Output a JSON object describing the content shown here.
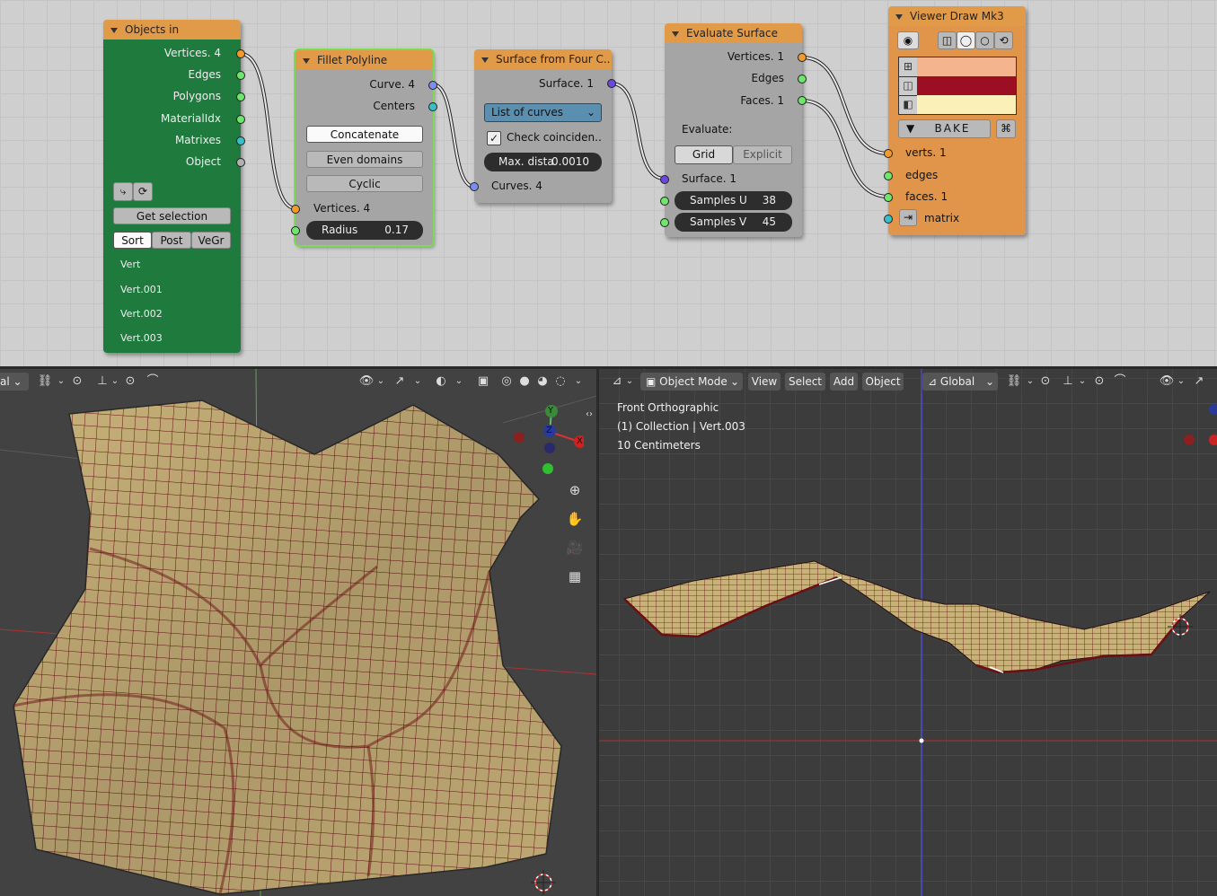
{
  "nodes": {
    "objects_in": {
      "title": "Objects in",
      "outputs": [
        "Vertices. 4",
        "Edges",
        "Polygons",
        "MaterialIdx",
        "Matrixes",
        "Object"
      ],
      "get_selection": "Get selection",
      "sort_tabs": [
        "Sort",
        "Post",
        "VeGr"
      ],
      "objects": [
        "Vert",
        "Vert.001",
        "Vert.002",
        "Vert.003"
      ]
    },
    "fillet_polyline": {
      "title": "Fillet Polyline",
      "outputs": [
        "Curve. 4",
        "Centers"
      ],
      "concatenate": "Concatenate",
      "even_domains": "Even domains",
      "cyclic": "Cyclic",
      "input_vertices": "Vertices. 4",
      "radius_label": "Radius",
      "radius_value": "0.17"
    },
    "surface_four_curves": {
      "title": "Surface from Four C..",
      "output": "Surface. 1",
      "mode": "List of curves",
      "check_label": "Check coinciden..",
      "check_checked": true,
      "max_label": "Max. dista",
      "max_value": "0.0010",
      "input_curves": "Curves. 4"
    },
    "evaluate_surface": {
      "title": "Evaluate Surface",
      "outputs": [
        "Vertices. 1",
        "Edges",
        "Faces. 1"
      ],
      "evaluate_label": "Evaluate:",
      "modes": [
        "Grid",
        "Explicit"
      ],
      "input_surface": "Surface. 1",
      "samples_u_label": "Samples U",
      "samples_u": "38",
      "samples_v_label": "Samples V",
      "samples_v": "45"
    },
    "viewer_draw": {
      "title": "Viewer Draw Mk3",
      "bake": "BAKE",
      "colors": [
        "#f4b48e",
        "#9b0e23",
        "#fbf0b8"
      ],
      "inputs": [
        "verts. 1",
        "edges",
        "faces. 1",
        "matrix"
      ]
    }
  },
  "left_viewport": {
    "header_cut_label": "al",
    "gizmo": {
      "x": "X",
      "y": "Y",
      "z": "Z"
    }
  },
  "right_viewport": {
    "mode": "Object Mode",
    "menus": [
      "View",
      "Select",
      "Add",
      "Object"
    ],
    "orientation": "Global",
    "info_lines": [
      "Front Orthographic",
      "(1) Collection | Vert.003",
      "10 Centimeters"
    ]
  },
  "colors": {
    "node_header": "#e09a48",
    "objects_in_body": "#1f7a3e",
    "viewer_body": "#e0954a",
    "mesh_face": "#c9b27a",
    "mesh_edge": "#6b0f14"
  }
}
